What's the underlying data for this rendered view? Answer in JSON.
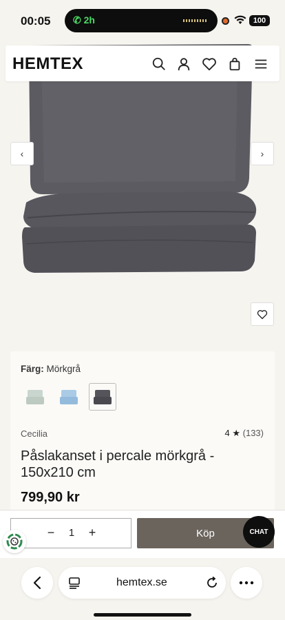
{
  "status_bar": {
    "time": "00:05",
    "call_duration": "2h",
    "battery": "100",
    "icons": [
      "phone-icon",
      "recording-dot-icon",
      "wifi-icon",
      "battery-icon"
    ]
  },
  "header": {
    "logo": "HEMTEX",
    "icons": [
      "search-icon",
      "user-icon",
      "heart-icon",
      "bag-icon",
      "menu-icon"
    ]
  },
  "gallery": {
    "prev_label": "‹",
    "next_label": "›"
  },
  "product": {
    "color_label": "Färg:",
    "color_value": "Mörkgrå",
    "swatches": [
      {
        "name": "Ljusgrön",
        "color": "#c9d6cf"
      },
      {
        "name": "Ljusblå",
        "color": "#a9cbe6"
      },
      {
        "name": "Mörkgrå",
        "color": "#55545a",
        "selected": true
      }
    ],
    "brand": "Cecilia",
    "rating": "4",
    "rating_star": "★",
    "rating_count": "(133)",
    "title": "Påslakanset i percale mörkgrå - 150x210 cm",
    "price": "799,90 kr"
  },
  "buy_bar": {
    "minus": "−",
    "quantity": "1",
    "plus": "+",
    "buy_label": "Köp",
    "chat_label": "CHAT"
  },
  "browser": {
    "url": "hemtex.se"
  },
  "colors": {
    "background": "#f6f4ef",
    "buy_button": "#6b645d",
    "chat_button": "#0e0e0e",
    "duvet": "#55545a"
  }
}
